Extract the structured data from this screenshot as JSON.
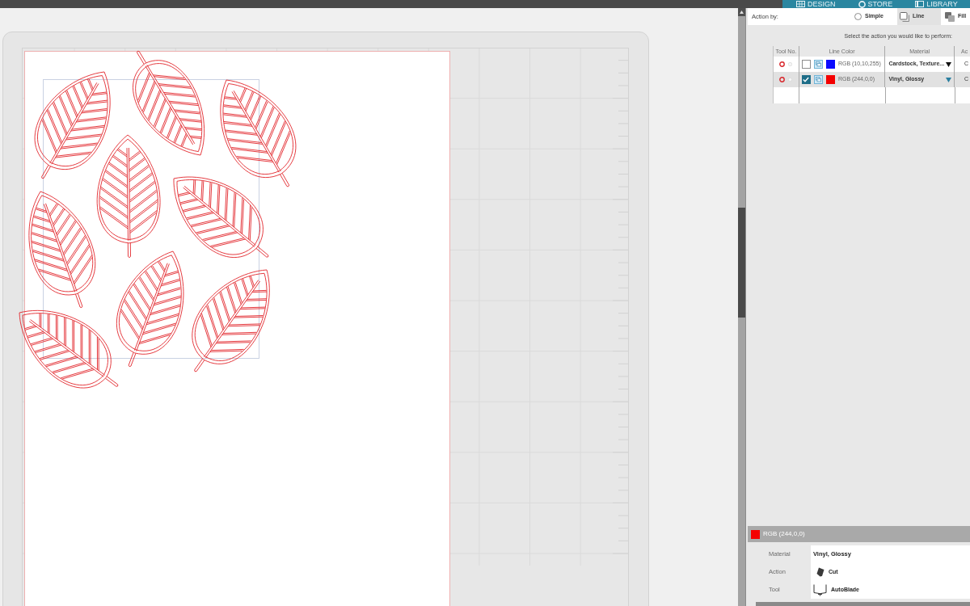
{
  "nav_tabs": [
    {
      "label": "DESIGN",
      "kind": "design"
    },
    {
      "label": "STORE",
      "kind": "store"
    },
    {
      "label": "LIBRARY",
      "kind": "library"
    }
  ],
  "action_by": {
    "label": "Action by:",
    "options": [
      {
        "label": "Simple",
        "kind": "radio",
        "selected": false
      },
      {
        "label": "Line",
        "kind": "line",
        "selected": true
      },
      {
        "label": "Fill",
        "kind": "fill",
        "selected": false
      }
    ]
  },
  "instruction": "Select the action you would like to perform:",
  "table": {
    "columns": [
      "Tool No.",
      "Line Color",
      "Material",
      "Ac"
    ],
    "rows": [
      {
        "selected": false,
        "checked": false,
        "color": "#0a0aff",
        "color_label": "RGB (10,10,255)",
        "material": "Cardstock, Texture...",
        "column_4": "C"
      },
      {
        "selected": true,
        "checked": true,
        "color": "#f40000",
        "color_label": "RGB (244,0,0)",
        "material": "Vinyl, Glossy",
        "column_4": "C"
      }
    ]
  },
  "details": {
    "color": "#f40000",
    "title": "RGB (244,0,0)",
    "fields": [
      {
        "label": "Material",
        "value": "Vinyl, Glossy",
        "kind": "text"
      },
      {
        "label": "Action",
        "value": "Cut",
        "kind": "blade"
      },
      {
        "label": "Tool",
        "value": "AutoBlade",
        "kind": "holder"
      }
    ]
  }
}
